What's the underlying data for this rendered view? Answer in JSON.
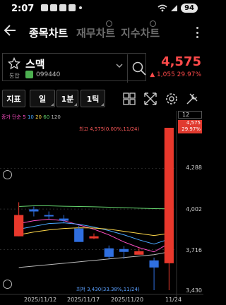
{
  "status": {
    "time": "2:07",
    "battery": "94"
  },
  "header": {
    "tabs": [
      {
        "label": "종목차트"
      },
      {
        "label": "재무차트"
      },
      {
        "label": "지수차트"
      }
    ]
  },
  "stock": {
    "name": "스맥",
    "market": "통합",
    "code": "099440",
    "price": "4,575",
    "change": "▲ 1,055  29.97%"
  },
  "toolbar": {
    "indicator": "지표",
    "day": "일",
    "min": "1분",
    "tick": "1틱"
  },
  "chart": {
    "legend": {
      "prefix": "종가 단순",
      "p5": "5",
      "p10": "10",
      "p20": "20",
      "p60": "60",
      "p120": "120"
    },
    "top_box": "12",
    "price_box": {
      "price": "4,575",
      "pct": "29.97%"
    },
    "y_labels": [
      "4,288",
      "4,002",
      "3,716",
      "3,430"
    ],
    "x_labels": [
      "2025/11/12",
      "2025/11/17",
      "2025/11/20",
      "11/24"
    ],
    "high_tag": "최고 4,575(0.00%,11/24)",
    "low_tag": "최저 3,430(33.38%,11/24)",
    "colors": {
      "up": "#e8382c",
      "down": "#2f6fe0"
    }
  },
  "chart_data": {
    "type": "candlestick",
    "ylim": [
      3430,
      4575
    ],
    "candles": [
      {
        "o": 3960,
        "h": 4050,
        "l": 3810,
        "c": 3810,
        "dir": "up"
      },
      {
        "o": 3985,
        "h": 4020,
        "l": 3950,
        "c": 4000,
        "dir": "down"
      },
      {
        "o": 3955,
        "h": 3985,
        "l": 3930,
        "c": 3960,
        "dir": "down"
      },
      {
        "o": 3935,
        "h": 3960,
        "l": 3905,
        "c": 3920,
        "dir": "down"
      },
      {
        "o": 3865,
        "h": 3885,
        "l": 3790,
        "c": 3770,
        "dir": "down"
      },
      {
        "o": 3810,
        "h": 3830,
        "l": 3790,
        "c": 3795,
        "dir": "up"
      },
      {
        "o": 3725,
        "h": 3745,
        "l": 3650,
        "c": 3665,
        "dir": "down"
      },
      {
        "o": 3720,
        "h": 3740,
        "l": 3650,
        "c": 3700,
        "dir": "down"
      },
      {
        "o": 3705,
        "h": 3725,
        "l": 3685,
        "c": 3680,
        "dir": "up"
      },
      {
        "o": 3640,
        "h": 3660,
        "l": 3430,
        "c": 3590,
        "dir": "down"
      },
      {
        "o": 3620,
        "h": 4575,
        "l": 3430,
        "c": 4575,
        "dir": "up"
      }
    ],
    "ma_lines": [
      {
        "name": "5",
        "color": "#ff4fc6",
        "values": [
          3900,
          3920,
          3930,
          3920,
          3890,
          3860,
          3820,
          3770,
          3730,
          3700,
          3760
        ]
      },
      {
        "name": "10",
        "color": "#4aa8ff",
        "values": [
          3860,
          3880,
          3900,
          3905,
          3895,
          3875,
          3850,
          3820,
          3785,
          3755,
          3790
        ]
      },
      {
        "name": "20",
        "color": "#ffd84a",
        "values": [
          3820,
          3840,
          3855,
          3865,
          3870,
          3868,
          3860,
          3845,
          3830,
          3815,
          3830
        ]
      },
      {
        "name": "60",
        "color": "#65d46e",
        "values": [
          4020,
          4025,
          4025,
          4022,
          4020,
          4018,
          4015,
          4012,
          4008,
          4005,
          4004
        ]
      },
      {
        "name": "120",
        "color": "#b9b9b9",
        "values": [
          3590,
          3600,
          3610,
          3620,
          3630,
          3640,
          3650,
          3660,
          3670,
          3680,
          3700
        ]
      }
    ]
  }
}
